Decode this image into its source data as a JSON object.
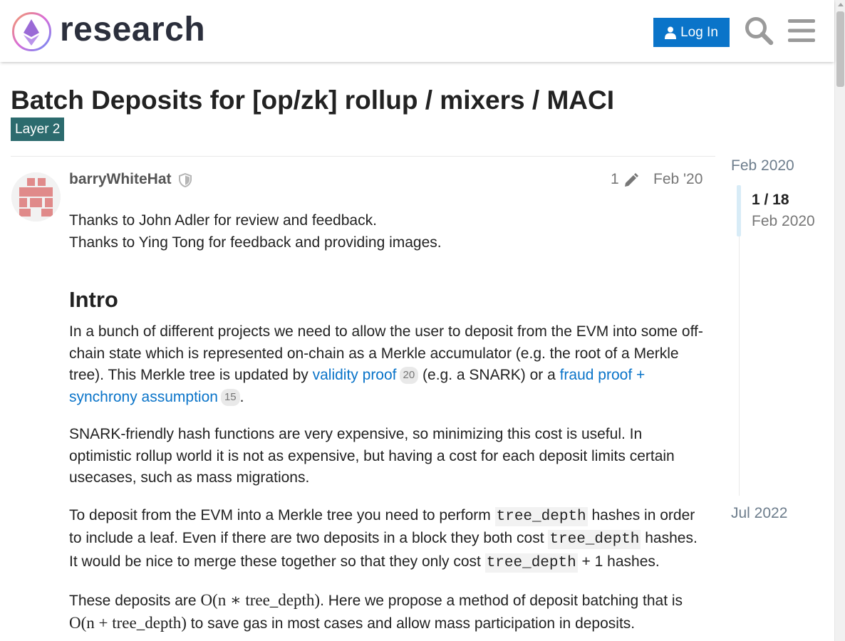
{
  "header": {
    "logo_text": "research",
    "login_label": "Log In",
    "icons": [
      "user-icon",
      "search-icon",
      "hamburger-menu-icon"
    ],
    "accent_color": "#0a74c9"
  },
  "topic": {
    "title": "Batch Deposits for [op/zk] rollup / mixers / MACI",
    "category": "Layer 2",
    "category_color": "#2c6b6e"
  },
  "post": {
    "author": "barryWhiteHat",
    "edit_count": "1",
    "date": "Feb '20",
    "thanks_1": "Thanks to John Adler for review and feedback.",
    "thanks_2": "Thanks to Ying Tong for feedback and providing images.",
    "heading": "Intro",
    "p1_text_a": "In a bunch of different projects we need to allow the user to deposit from the EVM into some off-chain state which is represented on-chain as a Merkle accumulator (e.g. the root of a Merkle tree). This Merkle tree is updated by ",
    "p1_link_1": "validity proof",
    "p1_link_1_clicks": "20",
    "p1_text_b": " (e.g. a SNARK) or a ",
    "p1_link_2": "fraud proof + synchrony assumption",
    "p1_link_2_clicks": "15",
    "p1_text_c": ".",
    "p2": "SNARK-friendly hash functions are very expensive, so minimizing this cost is useful. In optimistic rollup world it is not as expensive, but having a cost for each deposit limits certain usecases, such as mass migrations.",
    "p3_a": "To deposit from the EVM into a Merkle tree you need to perform ",
    "p3_code_1": "tree_depth",
    "p3_b": " hashes in order to include a leaf. Even if there are two deposits in a block they both cost ",
    "p3_code_2": "tree_depth",
    "p3_c": " hashes. It would be nice to merge these together so that they only cost ",
    "p3_code_3": "tree_depth",
    "p3_d": " + 1 hashes.",
    "p4_a": "These deposits are ",
    "p4_math": "O(n ∗ tree_depth)",
    "p4_b": ". Here we propose a method of deposit batching that is ",
    "p4_math_2": "O(n + tree_depth)",
    "p4_c": " to save gas in most cases and allow mass participation in deposits."
  },
  "timeline": {
    "start": "Feb 2020",
    "position": "1 / 18",
    "position_date": "Feb 2020",
    "end": "Jul 2022"
  }
}
